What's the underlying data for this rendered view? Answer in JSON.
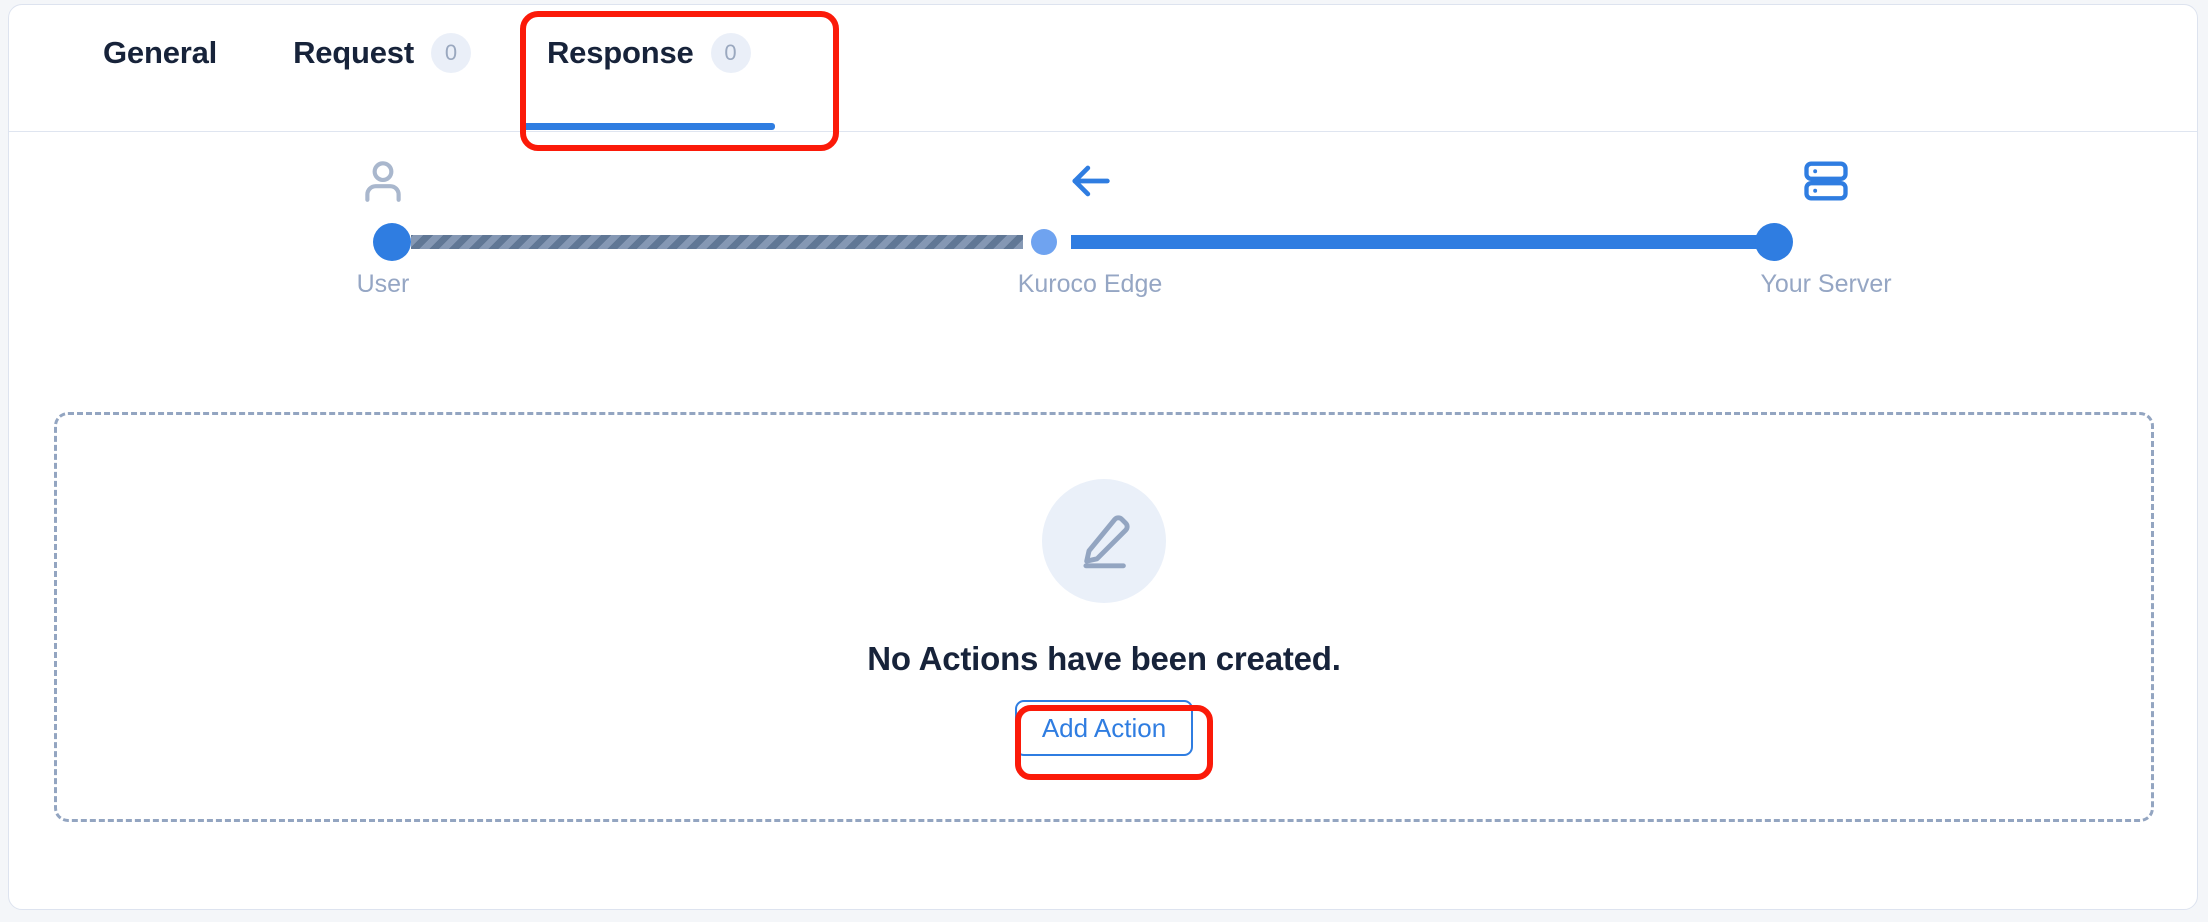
{
  "window": {
    "background_color": "#f4f6f9",
    "card_background": "#ffffff"
  },
  "theme": {
    "accent_blue": "#2f7de1",
    "light_blue_dot": "#6fa3f0",
    "text_dark": "#17233a",
    "muted_label": "#95a6c4",
    "badge_bg": "#eaeff8",
    "badge_text": "#9aa8bf",
    "dashed_border": "#93a5c1",
    "annotation_red": "#fb1a09",
    "hatch_light": "#8598b4",
    "hatch_dark": "#607795"
  },
  "tabs": {
    "items": [
      {
        "label": "General",
        "badge": null,
        "active": false
      },
      {
        "label": "Request",
        "badge": "0",
        "active": false
      },
      {
        "label": "Response",
        "badge": "0",
        "active": true
      }
    ]
  },
  "flow": {
    "nodes": [
      {
        "label": "User",
        "icon": "user-icon",
        "icon_color": "#a9b7cd"
      },
      {
        "label": "Kuroco Edge",
        "icon": "arrow-left-icon",
        "icon_color": "#2f7de1"
      },
      {
        "label": "Your Server",
        "icon": "server-icon",
        "icon_color": "#2f7de1"
      }
    ],
    "segments": [
      {
        "style": "hatched",
        "from": "User",
        "to": "Kuroco Edge"
      },
      {
        "style": "solid",
        "from": "Kuroco Edge",
        "to": "Your Server"
      }
    ]
  },
  "empty_state": {
    "icon": "pencil-edit-icon",
    "title": "No Actions have been created.",
    "button_label": "Add Action"
  },
  "annotations": [
    {
      "target": "tab-response",
      "shape": "rounded-rect",
      "color": "#fb1a09"
    },
    {
      "target": "add-action-button",
      "shape": "rounded-rect",
      "color": "#fb1a09"
    }
  ]
}
